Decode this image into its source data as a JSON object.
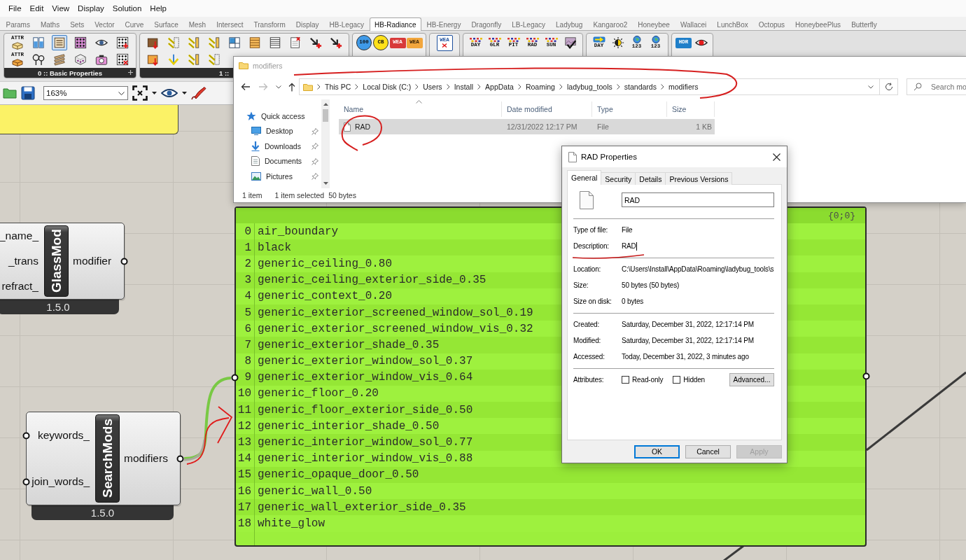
{
  "menu": [
    "File",
    "Edit",
    "View",
    "Display",
    "Solution",
    "Help"
  ],
  "tabs": [
    {
      "label": "Params",
      "selected": false
    },
    {
      "label": "Maths",
      "selected": false
    },
    {
      "label": "Sets",
      "selected": false
    },
    {
      "label": "Vector",
      "selected": false
    },
    {
      "label": "Curve",
      "selected": false
    },
    {
      "label": "Surface",
      "selected": false
    },
    {
      "label": "Mesh",
      "selected": false
    },
    {
      "label": "Intersect",
      "selected": false
    },
    {
      "label": "Transform",
      "selected": false
    },
    {
      "label": "Display",
      "selected": false
    },
    {
      "label": "HB-Legacy",
      "selected": false
    },
    {
      "label": "HB-Radiance",
      "selected": true
    },
    {
      "label": "HB-Energy",
      "selected": false
    },
    {
      "label": "Dragonfly",
      "selected": false
    },
    {
      "label": "LB-Legacy",
      "selected": false
    },
    {
      "label": "Ladybug",
      "selected": false
    },
    {
      "label": "Kangaroo2",
      "selected": false
    },
    {
      "label": "Honeybee",
      "selected": false
    },
    {
      "label": "Wallacei",
      "selected": false
    },
    {
      "label": "LunchBox",
      "selected": false
    },
    {
      "label": "Octopus",
      "selected": false
    },
    {
      "label": "HoneybeePlus",
      "selected": false
    },
    {
      "label": "Butterfly",
      "selected": false
    }
  ],
  "ribbon": {
    "groups": [
      {
        "title": "0 :: Basic Properties",
        "tools": [
          {
            "label": "ATTR",
            "selected": false
          },
          {
            "label": "ATTR",
            "selected": false
          },
          {
            "selected": false
          },
          {
            "selected": false
          },
          {
            "selected": true
          },
          {
            "selected": false
          },
          {
            "selected": false
          },
          {
            "selected": false
          },
          {
            "selected": false
          },
          {
            "selected": false
          },
          {
            "selected": false
          },
          {
            "selected": false
          }
        ]
      },
      {
        "title": "1 ::",
        "tools": [
          {
            "selected": false
          },
          {
            "selected": false
          },
          {
            "selected": false
          },
          {
            "selected": false
          },
          {
            "selected": false
          },
          {
            "selected": false
          },
          {
            "selected": false
          },
          {
            "selected": false
          },
          {
            "selected": false
          },
          {
            "selected": false
          },
          {
            "selected": false
          },
          {
            "selected": false
          },
          {
            "selected": false
          },
          {
            "selected": false
          }
        ]
      },
      {
        "tools": [
          {
            "label": "100",
            "selected": false
          },
          {
            "label": "CB",
            "selected": false
          },
          {
            "label": "WEA",
            "selected": false
          },
          {
            "label": "WEA",
            "selected": false
          }
        ]
      },
      {
        "tools": [
          {
            "label": "WEA",
            "selected": false
          }
        ]
      },
      {
        "tools": [
          {
            "label": "DAY",
            "selected": false
          },
          {
            "label": "GLR",
            "selected": false
          },
          {
            "label": "PIT",
            "selected": false
          },
          {
            "label": "RAD",
            "selected": false
          },
          {
            "label": "SUN",
            "selected": false
          },
          {
            "selected": false
          }
        ]
      },
      {
        "tools": [
          {
            "label": "DAY",
            "selected": false
          },
          {
            "selected": false
          },
          {
            "label": "123",
            "selected": false
          },
          {
            "label": "123",
            "selected": false
          }
        ]
      },
      {
        "tools": [
          {
            "label": "HDR",
            "selected": false
          },
          {
            "selected": false
          }
        ]
      }
    ]
  },
  "canvas_toolbar": {
    "zoom": "163%"
  },
  "canvas": {
    "components": [
      {
        "name": "GlassMod",
        "inputs": [
          "_name_",
          "_trans",
          "refract_"
        ],
        "outputs": [
          "modifier"
        ],
        "version": "1.5.0"
      },
      {
        "name": "SearchMods",
        "inputs": [
          "keywords_",
          "join_words_"
        ],
        "outputs": [
          "modifiers"
        ],
        "version": "1.5.0"
      }
    ],
    "panel": {
      "path": "{0;0}",
      "rows": [
        {
          "index": "0",
          "text": "air_boundary"
        },
        {
          "index": "1",
          "text": "black"
        },
        {
          "index": "2",
          "text": "generic_ceiling_0.80"
        },
        {
          "index": "3",
          "text": "generic_ceiling_exterior_side_0.35"
        },
        {
          "index": "4",
          "text": "generic_context_0.20"
        },
        {
          "index": "5",
          "text": "generic_exterior_screened_window_sol_0.19"
        },
        {
          "index": "6",
          "text": "generic_exterior_screened_window_vis_0.32"
        },
        {
          "index": "7",
          "text": "generic_exterior_shade_0.35"
        },
        {
          "index": "8",
          "text": "generic_exterior_window_sol_0.37"
        },
        {
          "index": "9",
          "text": "generic_exterior_window_vis_0.64"
        },
        {
          "index": "10",
          "text": "generic_floor_0.20"
        },
        {
          "index": "11",
          "text": "generic_floor_exterior_side_0.50"
        },
        {
          "index": "12",
          "text": "generic_interior_shade_0.50"
        },
        {
          "index": "13",
          "text": "generic_interior_window_sol_0.77"
        },
        {
          "index": "14",
          "text": "generic_interior_window_vis_0.88"
        },
        {
          "index": "15",
          "text": "generic_opaque_door_0.50"
        },
        {
          "index": "16",
          "text": "generic_wall_0.50"
        },
        {
          "index": "17",
          "text": "generic_wall_exterior_side_0.35"
        },
        {
          "index": "18",
          "text": "white_glow"
        }
      ]
    }
  },
  "explorer": {
    "title": "modifiers",
    "forward_disabled": true,
    "breadcrumb": [
      "This PC",
      "Local Disk (C:)",
      "Users",
      "Install",
      "AppData",
      "Roaming",
      "ladybug_tools",
      "standards",
      "modifiers"
    ],
    "search_placeholder": "Search mo",
    "nav": [
      {
        "label": "Quick access",
        "children": [
          {
            "label": "Desktop",
            "pinned": true
          },
          {
            "label": "Downloads",
            "pinned": true
          },
          {
            "label": "Documents",
            "pinned": true
          },
          {
            "label": "Pictures",
            "pinned": true
          }
        ]
      }
    ],
    "columns": [
      "Name",
      "Date modified",
      "Type",
      "Size"
    ],
    "rows": [
      {
        "name": "RAD",
        "date_modified": "12/31/2022 12:17 PM",
        "type": "File",
        "size": "1 KB",
        "selected": true
      }
    ],
    "status": {
      "count": "1 item",
      "selection": "1 item selected",
      "size": "50 bytes"
    }
  },
  "properties": {
    "title": "RAD Properties",
    "tabs": [
      {
        "label": "General",
        "selected": true
      },
      {
        "label": "Security",
        "selected": false
      },
      {
        "label": "Details",
        "selected": false
      },
      {
        "label": "Previous Versions",
        "selected": false
      }
    ],
    "name": "RAD",
    "sections": [
      [
        {
          "label": "Type of file:",
          "value": "File",
          "editing": false
        },
        {
          "label": "Description:",
          "value": "RAD",
          "editing": true
        }
      ],
      [
        {
          "label": "Location:",
          "value": "C:\\Users\\Install\\AppData\\Roaming\\ladybug_tools\\s",
          "editing": false
        },
        {
          "label": "Size:",
          "value": "50 bytes (50 bytes)",
          "editing": false
        },
        {
          "label": "Size on disk:",
          "value": "0 bytes",
          "editing": false
        }
      ],
      [
        {
          "label": "Created:",
          "value": "Saturday, December 31, 2022, 12:17:14 PM",
          "editing": false
        },
        {
          "label": "Modified:",
          "value": "Saturday, December 31, 2022, 12:17:14 PM",
          "editing": false
        },
        {
          "label": "Accessed:",
          "value": "Today, December 31, 2022, 3 minutes ago",
          "editing": false
        }
      ]
    ],
    "attributes": {
      "label": "Attributes:",
      "checkboxes": [
        {
          "label": "Read-only",
          "checked": false
        },
        {
          "label": "Hidden",
          "checked": false
        }
      ],
      "button": "Advanced..."
    },
    "buttons": [
      {
        "label": "OK",
        "default": true,
        "disabled": false
      },
      {
        "label": "Cancel",
        "default": false,
        "disabled": false
      },
      {
        "label": "Apply",
        "default": false,
        "disabled": true
      }
    ]
  }
}
